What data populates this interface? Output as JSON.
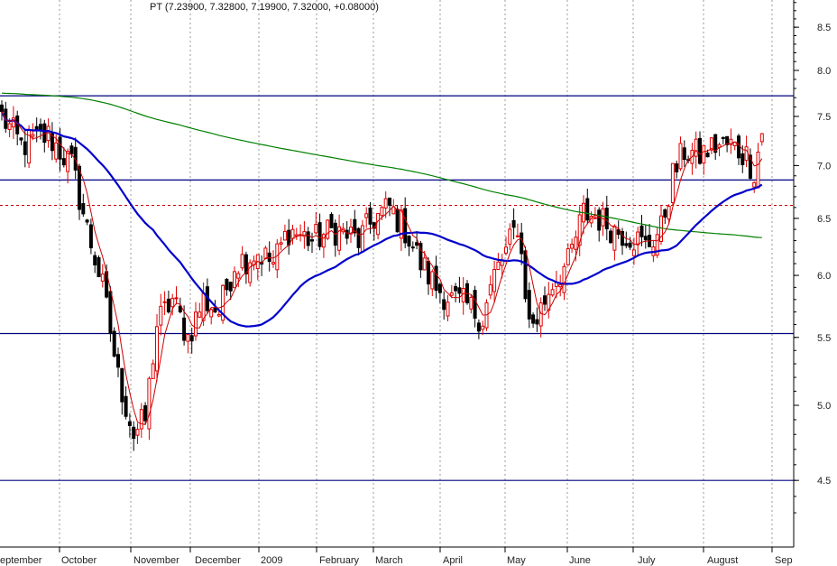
{
  "chart_data": {
    "type": "candlestick",
    "title": "PT (7.23900, 7.32800, 7.19900, 7.32000, +0.08000)",
    "y_scale": "log",
    "ylim": [
      4.2,
      9.1
    ],
    "y_ticks": [
      "8.5",
      "8.0",
      "7.5",
      "7.0",
      "6.5",
      "6.0",
      "5.5",
      "5.0",
      "4.5"
    ],
    "x_labels": [
      "eptember",
      "October",
      "November",
      "December",
      "2009",
      "February",
      "March",
      "April",
      "May",
      "June",
      "July",
      "August",
      "Sep"
    ],
    "grid": "vertical dotted",
    "colors": {
      "up": "#e00000",
      "down": "#000000",
      "ma_short": "#cc0000",
      "ma_mid": "#0000cc",
      "ma_long": "#008000",
      "hline": "#000080",
      "hline_dashed": "#cc0000"
    },
    "horizontal_lines": [
      7.72,
      6.86,
      5.53,
      4.5
    ],
    "dashed_line": 6.62,
    "close_waypoints": [
      [
        0,
        7.5
      ],
      [
        5,
        7.2
      ],
      [
        12,
        7.3
      ],
      [
        18,
        7.0
      ],
      [
        22,
        6.4
      ],
      [
        26,
        5.9
      ],
      [
        30,
        5.2
      ],
      [
        34,
        4.8
      ],
      [
        37,
        4.9
      ],
      [
        40,
        5.6
      ],
      [
        44,
        5.8
      ],
      [
        48,
        5.5
      ],
      [
        52,
        5.8
      ],
      [
        56,
        5.7
      ],
      [
        60,
        6.1
      ],
      [
        66,
        6.2
      ],
      [
        70,
        6.1
      ],
      [
        74,
        6.4
      ],
      [
        80,
        6.3
      ],
      [
        86,
        6.4
      ],
      [
        92,
        6.3
      ],
      [
        96,
        6.5
      ],
      [
        100,
        6.6
      ],
      [
        104,
        6.4
      ],
      [
        108,
        6.1
      ],
      [
        112,
        5.9
      ],
      [
        116,
        5.8
      ],
      [
        120,
        5.75
      ],
      [
        124,
        5.65
      ],
      [
        127,
        6.0
      ],
      [
        130,
        6.2
      ],
      [
        133,
        6.45
      ],
      [
        136,
        5.6
      ],
      [
        138,
        5.65
      ],
      [
        142,
        5.95
      ],
      [
        146,
        6.1
      ],
      [
        150,
        6.55
      ],
      [
        154,
        6.5
      ],
      [
        158,
        6.4
      ],
      [
        162,
        6.35
      ],
      [
        166,
        6.25
      ],
      [
        170,
        6.4
      ],
      [
        173,
        6.9
      ],
      [
        176,
        7.15
      ],
      [
        180,
        7.1
      ],
      [
        184,
        7.2
      ],
      [
        188,
        7.2
      ],
      [
        192,
        7.1
      ],
      [
        194,
        6.95
      ],
      [
        196,
        7.32
      ]
    ],
    "series": [
      {
        "type": "ohlc",
        "last": {
          "open": 7.239,
          "high": 7.328,
          "low": 7.199,
          "close": 7.32,
          "change": 0.08
        }
      },
      {
        "type": "line",
        "window": 5
      },
      {
        "type": "line",
        "window": 40
      },
      {
        "type": "line",
        "window": 200
      }
    ]
  }
}
